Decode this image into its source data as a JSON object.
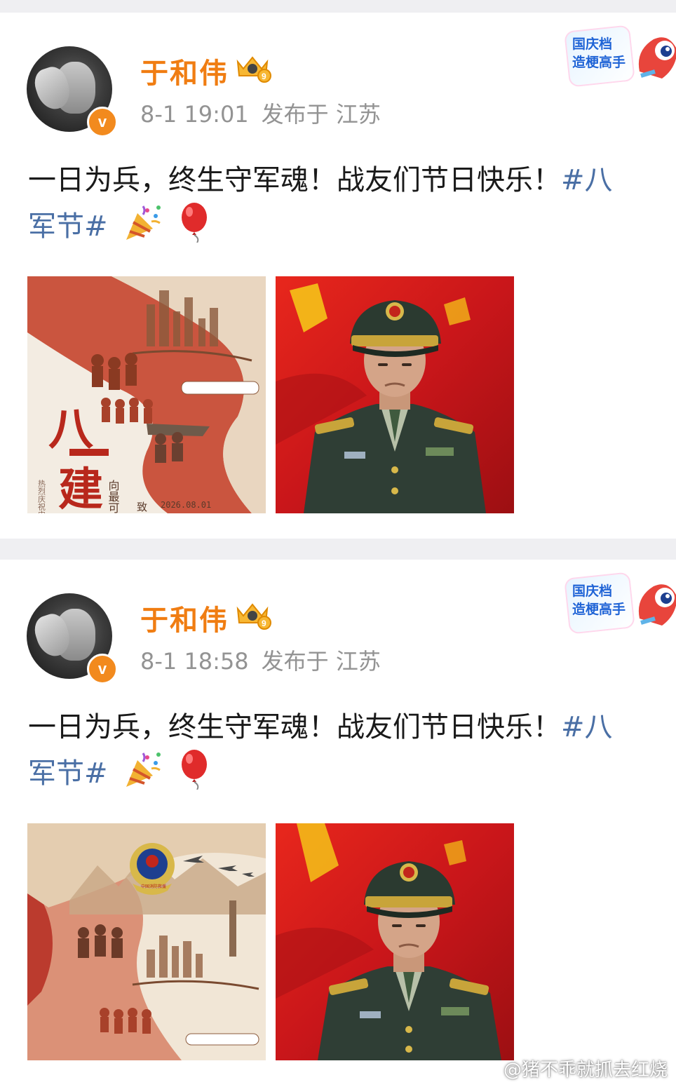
{
  "posts": [
    {
      "author": "于和伟",
      "time": "8-1 19:01",
      "location": "发布于 江苏",
      "text_line1": "一日为兵，终生守军魂！战友们节日快乐！",
      "hashtag_start": "#八",
      "hashtag_end": "军节#",
      "promo_line1": "国庆档",
      "promo_line2": "造梗高手",
      "image1": {
        "big_text": "八一建",
        "side_text": "向最可爱",
        "to_text": "致",
        "vertical_text": "热烈庆祝中",
        "date": "2026.08.01"
      }
    },
    {
      "author": "于和伟",
      "time": "8-1 18:58",
      "location": "发布于 江苏",
      "text_line1": "一日为兵，终生守军魂！战友们节日快乐！",
      "hashtag_start": "#八",
      "hashtag_end": "军节#",
      "promo_line1": "国庆档",
      "promo_line2": "造梗高手",
      "image1": {
        "emblem_text": "中国消防救援"
      }
    }
  ],
  "watermark": "@猪不乖就抓去红烧",
  "colors": {
    "username": "#f07d12",
    "meta": "#939393",
    "hashtag": "#4a6fa5",
    "verified": "#f28a1e",
    "background": "#efeff2"
  },
  "icons": {
    "verified": "verified-v-icon",
    "vip": "vip-crown-icon",
    "party": "party-popper-icon",
    "balloon": "red-balloon-icon"
  }
}
